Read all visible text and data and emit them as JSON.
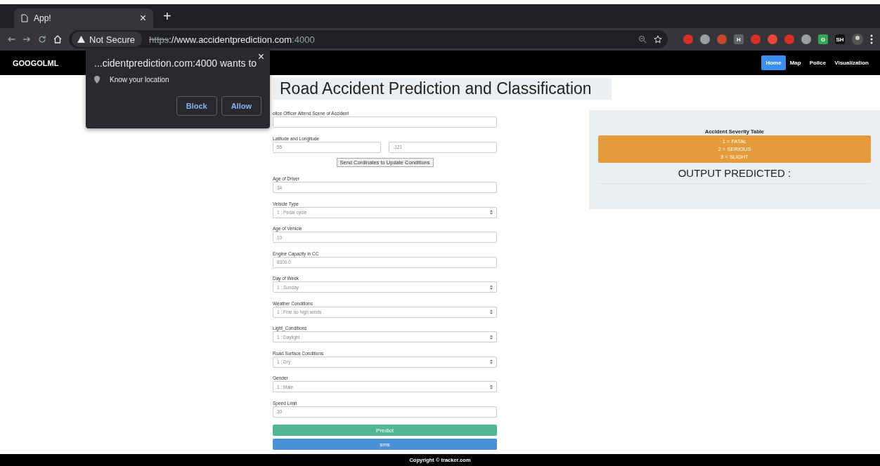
{
  "browser": {
    "tab": {
      "title": "App!",
      "close": "×"
    },
    "new_tab": "+",
    "security": "Not Secure",
    "url": {
      "scheme": "https",
      "rest": "://www.accidentprediction.com",
      "port": ":4000"
    },
    "extensions": [
      {
        "color": "#d93025"
      },
      {
        "color": "#9aa0a6"
      },
      {
        "color": "#c5472c"
      },
      {
        "color": "#5f6368",
        "label": "H"
      },
      {
        "color": "#d93025"
      },
      {
        "color": "#e8453c"
      },
      {
        "color": "#d93025"
      },
      {
        "color": "#9aa0a6"
      },
      {
        "color": "#34a853",
        "label": "G"
      },
      {
        "color": "#111111",
        "label": "SH"
      }
    ]
  },
  "permission_popup": {
    "title": "...cidentprediction.com:4000 wants to",
    "permission": "Know your location",
    "close": "×",
    "buttons": [
      "Block",
      "Allow"
    ]
  },
  "navbar": {
    "brand": "GOOGOLML",
    "links": [
      {
        "label": "Home",
        "selected": true
      },
      {
        "label": "Map",
        "selected": false
      },
      {
        "label": "Police",
        "selected": false
      },
      {
        "label": "Visualization",
        "selected": false
      }
    ]
  },
  "title": "Road Accident Prediction and Classification",
  "form": [
    {
      "kind": "text",
      "label": "olice Officer Attend Scene of Accident"
    },
    {
      "kind": "pair",
      "label": "Latitude and Longitude",
      "values": [
        "55",
        "-121"
      ]
    },
    {
      "kind": "button",
      "label": "Send Cordinates to Update Conditions"
    },
    {
      "kind": "text",
      "label": "Age of Driver",
      "value": "34"
    },
    {
      "kind": "select",
      "label": "Vehicle Type",
      "value": "1 : Pedal cycle"
    },
    {
      "kind": "text",
      "label": "Age of Vehicle",
      "value": "10"
    },
    {
      "kind": "text",
      "label": "Engine Capacity in CC",
      "value": "8300.0"
    },
    {
      "kind": "select",
      "label": "Day of Week",
      "value": "1 : Sunday"
    },
    {
      "kind": "select",
      "label": "Weather Conditions",
      "value": "1 : Fine no high winds"
    },
    {
      "kind": "select",
      "label": "Light_Conditions",
      "value": "1 : Daylight"
    },
    {
      "kind": "select",
      "label": "Road Surface Conditions",
      "value": "1 : Dry"
    },
    {
      "kind": "select",
      "label": "Gender",
      "value": "1 : Male"
    },
    {
      "kind": "text",
      "label": "Speed Limit",
      "value": "30"
    }
  ],
  "actions": [
    {
      "label": "Predict",
      "color": "#52b594"
    },
    {
      "label": "sms",
      "color": "#4a90d9"
    }
  ],
  "severity": {
    "title": "Accident Severity Table",
    "lines": [
      "1 = FATAL",
      "2 = SERIOUS",
      "3 = SLIGHT"
    ],
    "output": "OUTPUT PREDICTED :"
  },
  "footer": "Copyright © tracker.com"
}
